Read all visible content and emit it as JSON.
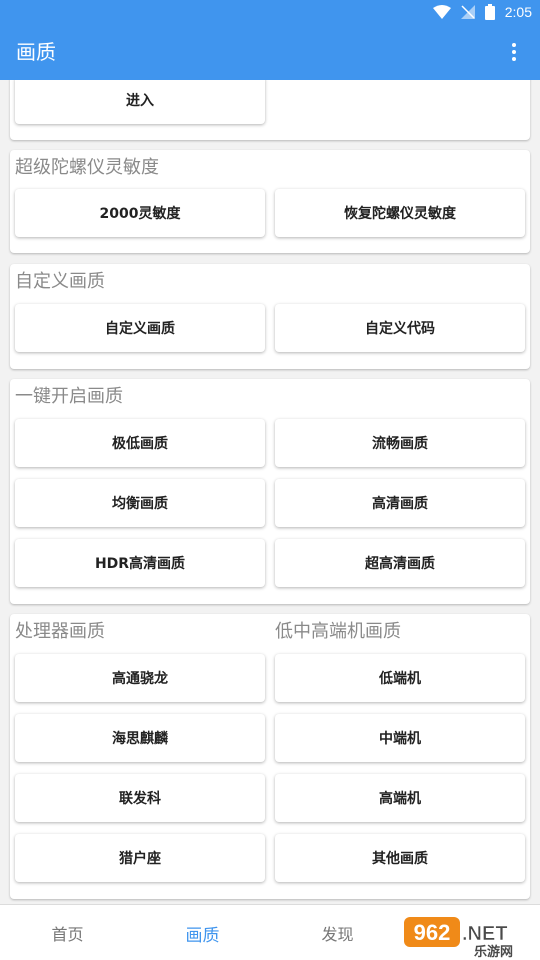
{
  "status_bar": {
    "time": "2:05"
  },
  "app_bar": {
    "title": "画质"
  },
  "sections": {
    "top": {
      "buttons": [
        "进入"
      ]
    },
    "gyro": {
      "title": "超级陀螺仪灵敏度",
      "buttons": [
        "2000灵敏度",
        "恢复陀螺仪灵敏度"
      ]
    },
    "custom": {
      "title": "自定义画质",
      "buttons": [
        "自定义画质",
        "自定义代码"
      ]
    },
    "one_key": {
      "title": "一键开启画质",
      "buttons": [
        "极低画质",
        "流畅画质",
        "均衡画质",
        "高清画质",
        "HDR高清画质",
        "超高清画质"
      ]
    },
    "processor": {
      "title": "处理器画质",
      "buttons": [
        "高通骁龙",
        "海思麒麟",
        "联发科",
        "猎户座"
      ]
    },
    "device_tier": {
      "title": "低中高端机画质",
      "buttons": [
        "低端机",
        "中端机",
        "高端机",
        "其他画质"
      ]
    }
  },
  "bottom_nav": {
    "items": [
      "首页",
      "画质",
      "发现"
    ],
    "active": "画质"
  },
  "watermark": {
    "brand": "962.NET",
    "site": "乐游网"
  },
  "colors": {
    "primary": "#4095ee",
    "section_title": "#8a8a8a",
    "background": "#f2f2f2"
  }
}
